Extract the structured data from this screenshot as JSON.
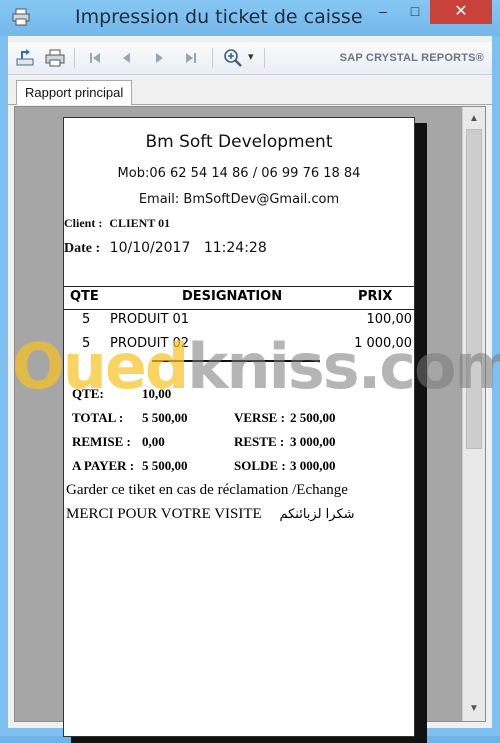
{
  "window": {
    "title": "Impression du ticket de caisse",
    "min_glyph": "–",
    "max_glyph": "□",
    "close_glyph": "✕"
  },
  "toolbar": {
    "brand": "SAP CRYSTAL REPORTS®",
    "zoom_caret": "▾"
  },
  "tabs": [
    {
      "label": "Rapport principal"
    }
  ],
  "scrollbar": {
    "up_glyph": "▲",
    "down_glyph": "▼"
  },
  "receipt": {
    "company": "Bm Soft Development",
    "mobile": "Mob:06 62 54 14 86 / 06 99 76 18 84",
    "email": "Email: BmSoftDev@Gmail.com",
    "client_label": "Client :",
    "client_value": "CLIENT 01",
    "date_label": "Date :",
    "date_value": "10/10/2017",
    "time_value": "11:24:28",
    "columns": {
      "qte": "QTE",
      "designation": "DESIGNATION",
      "prix": "PRIX"
    },
    "items": [
      {
        "qte": "5",
        "designation": "PRODUIT 01",
        "prix": "100,00"
      },
      {
        "qte": "5",
        "designation": "PRODUIT 02",
        "prix": "1 000,00"
      }
    ],
    "totals": {
      "qte_label": "QTE:",
      "qte_value": "10,00",
      "total_label": "TOTAL :",
      "total_value": "5 500,00",
      "verse_label": "VERSE :",
      "verse_value": "2 500,00",
      "remise_label": "REMISE :",
      "remise_value": "0,00",
      "reste_label": "RESTE :",
      "reste_value": "3 000,00",
      "apayer_label": "A PAYER :",
      "apayer_value": "5 500,00",
      "solde_label": "SOLDE :",
      "solde_value": "3 000,00"
    },
    "footer_1": "Garder ce tiket en cas de réclamation /Echange",
    "footer_2": "MERCI POUR VOTRE VISITE",
    "footer_arabic": "شكرا لزبائنكم"
  },
  "watermark": {
    "part_a": "Oued",
    "part_b": "kniss.com"
  },
  "colors": {
    "titlebar": "#7ec0ef",
    "close": "#c8413b",
    "viewer_bg": "#a6a6a6"
  }
}
